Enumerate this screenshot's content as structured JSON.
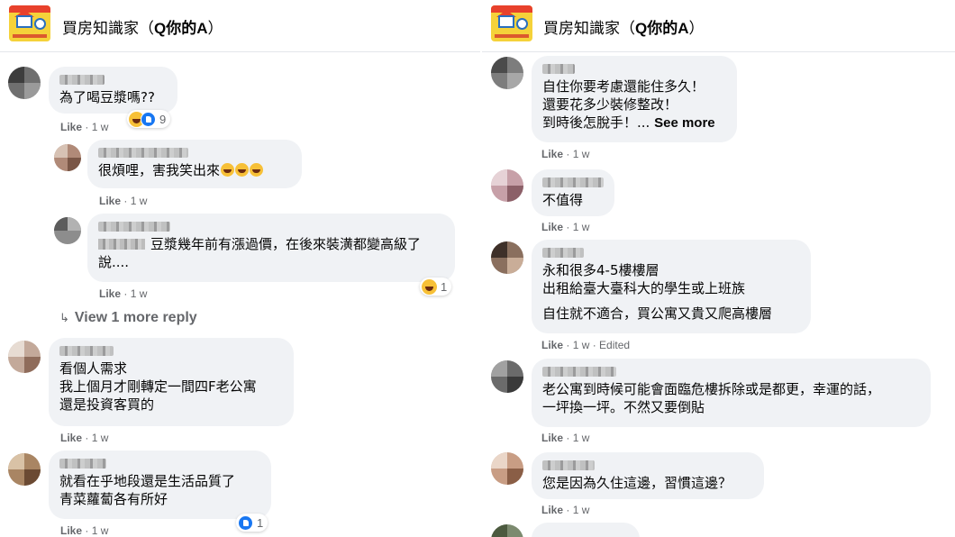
{
  "page": {
    "name_prefix": "買房知識家（",
    "name_bold": "Q你的A",
    "name_suffix": "）"
  },
  "left": {
    "comments": [
      {
        "text": "為了喝豆漿嗎??",
        "meta_like": "Like",
        "meta_time": "· 1 w",
        "reaction_count": "9"
      },
      {
        "text": "很煩哩，害我笑出來",
        "meta_like": "Like",
        "meta_time": "· 1 w"
      },
      {
        "text": "豆漿幾年前有漲過價，在後來裝潢都變高級了說....",
        "meta_like": "Like",
        "meta_time": "· 1 w",
        "reaction_count": "1"
      },
      {
        "text": "看個人需求\n我上個月才剛轉定一間四F老公寓\n還是投資客買的",
        "meta_like": "Like",
        "meta_time": "· 1 w"
      },
      {
        "text": "就看在乎地段還是生活品質了\n青菜蘿蔔各有所好",
        "meta_like": "Like",
        "meta_time": "· 1 w",
        "reaction_count": "1"
      }
    ],
    "view_more": "View 1 more reply"
  },
  "right": {
    "comments": [
      {
        "text": "自住你要考慮還能住多久！\n還要花多少裝修整改！\n到時後怎脫手！...",
        "see_more": "See more",
        "meta_like": "Like",
        "meta_time": "· 1 w"
      },
      {
        "text": "不值得",
        "meta_like": "Like",
        "meta_time": "· 1 w"
      },
      {
        "text": "永和很多4-5樓樓層\n出租給臺大臺科大的學生或上班族",
        "text2": "自住就不適合，買公寓又貴又爬高樓層",
        "meta_like": "Like",
        "meta_time": "· 1 w · Edited"
      },
      {
        "text": "老公寓到時候可能會面臨危樓拆除或是都更，幸運的話，\n一坪換一坪。不然又要倒貼",
        "meta_like": "Like",
        "meta_time": "· 1 w"
      },
      {
        "text": "您是因為久住這邊，習慣這邊？",
        "meta_like": "Like",
        "meta_time": "· 1 w"
      }
    ]
  },
  "colors": {
    "bubble": "#f0f2f5",
    "meta": "#65676b",
    "like_blue": "#1877f2",
    "haha_yellow": "#f7c037"
  },
  "icons": [
    "page-logo",
    "haha-icon",
    "like-icon",
    "reply-arrow-icon",
    "laugh-emoji"
  ]
}
